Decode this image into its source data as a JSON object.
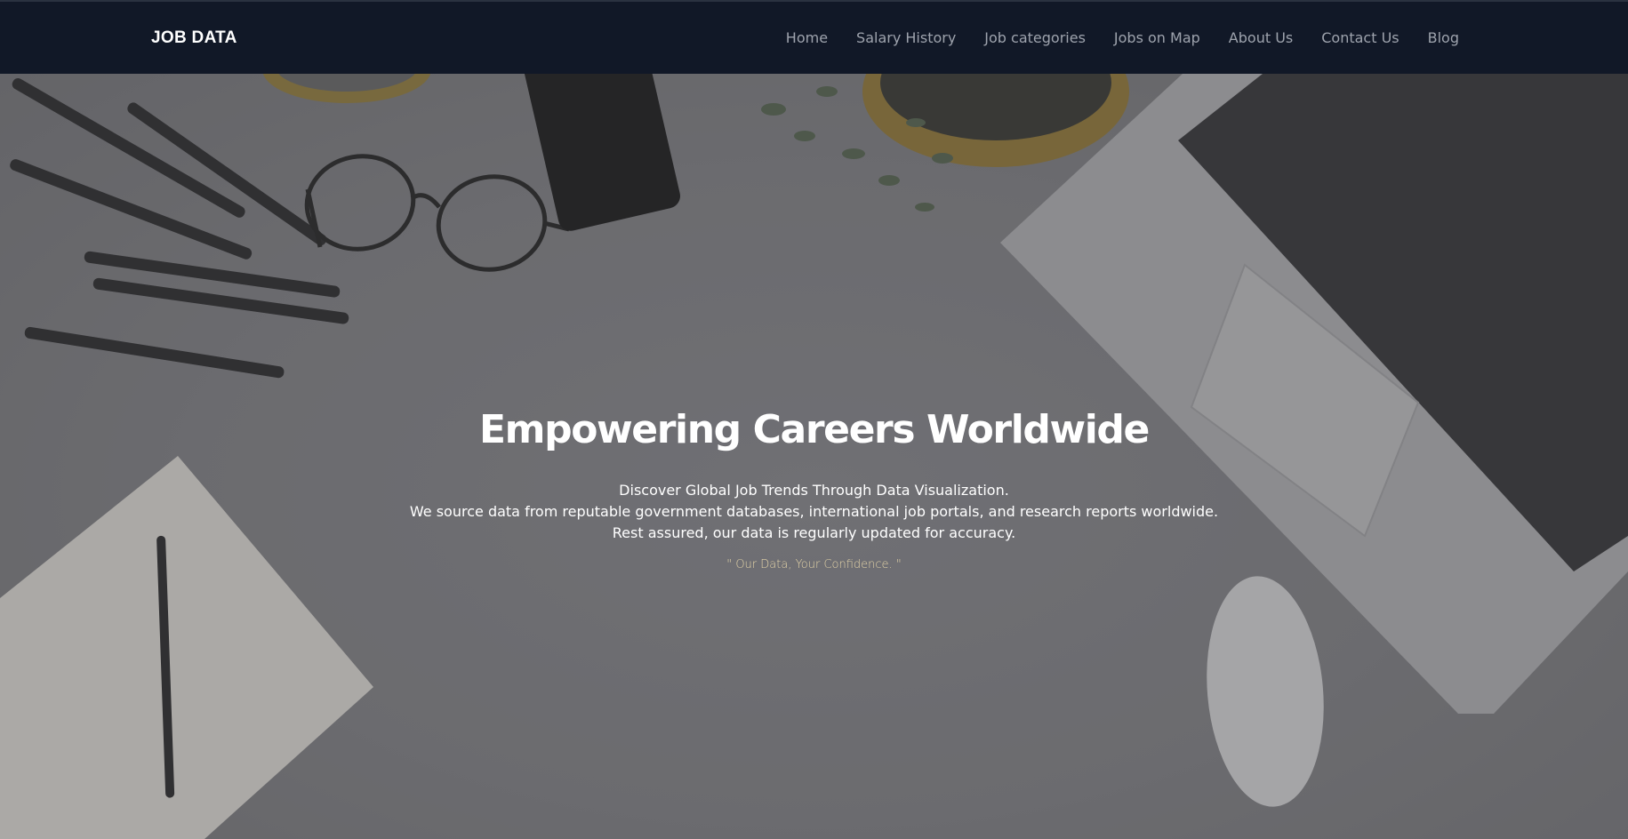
{
  "nav": {
    "brand": "JOB DATA",
    "links": [
      "Home",
      "Salary History",
      "Job categories",
      "Jobs on Map",
      "About Us",
      "Contact Us",
      "Blog"
    ]
  },
  "hero": {
    "headline": "Empowering Careers Worldwide",
    "lines": [
      "Discover Global Job Trends Through Data Visualization.",
      "We source data from reputable government databases, international job portals, and research reports worldwide.",
      "Rest assured, our data is regularly updated for accuracy."
    ],
    "tagline": "\" Our Data, Your Confidence. \""
  },
  "colors": {
    "nav_background": "#111827",
    "nav_link": "#9ea3ad",
    "tagline": "#e3d3a8"
  }
}
